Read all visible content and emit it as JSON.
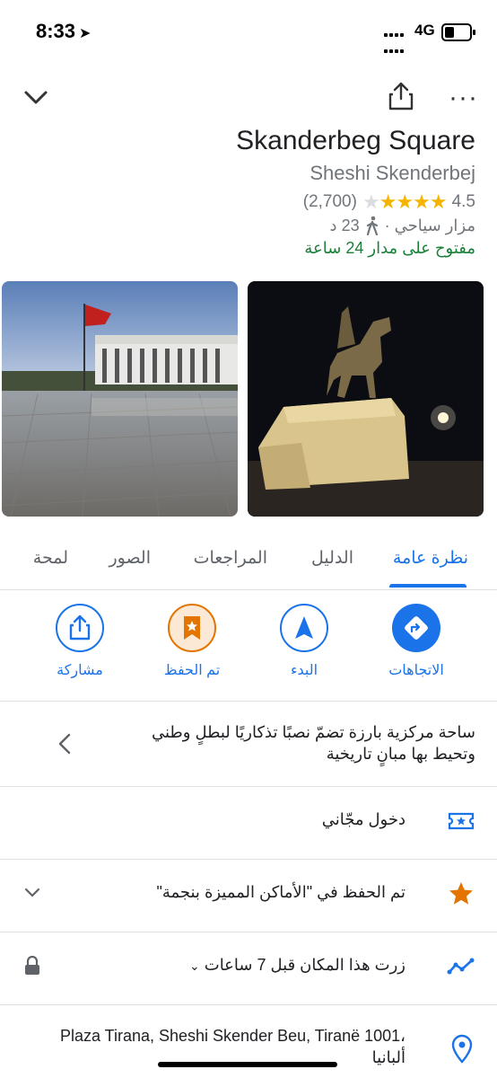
{
  "status": {
    "time": "8:33",
    "network": "4G"
  },
  "place": {
    "title": "Skanderbeg Square",
    "subtitle": "Sheshi Skenderbej",
    "rating": "4.5",
    "reviews": "(2,700)",
    "category": "مزار سياحي ·",
    "walk_time": "23 د",
    "hours": "مفتوح على مدار 24 ساعة"
  },
  "tabs": [
    "نظرة عامة",
    "الدليل",
    "المراجعات",
    "الصور",
    "لمحة"
  ],
  "actions": {
    "directions": "الاتجاهات",
    "start": "البدء",
    "saved": "تم الحفظ",
    "share": "مشاركة"
  },
  "description": "ساحة مركزية بارزة تضمّ نصبًا تذكاريًا لبطلٍ وطني وتحيط بها مبانٍ تاريخية",
  "rows": {
    "admission": "دخول مجّاني",
    "saved_list": "تم الحفظ في \"الأماكن المميزة بنجمة\"",
    "visited": "زرت هذا المكان قبل 7 ساعات",
    "address": "Plaza Tirana, Sheshi Skender Beu, Tiranë 1001، ألبانيا"
  },
  "colors": {
    "accent": "#1a73e8",
    "star": "#f4b400",
    "saved": "#e37400",
    "open": "#188038"
  },
  "icons": [
    "chevron-down-icon",
    "share-icon",
    "more-icon",
    "walk-icon",
    "directions-icon",
    "navigation-icon",
    "bookmark-star-icon",
    "ticket-icon",
    "star-icon",
    "timeline-icon",
    "lock-icon",
    "location-pin-icon"
  ]
}
